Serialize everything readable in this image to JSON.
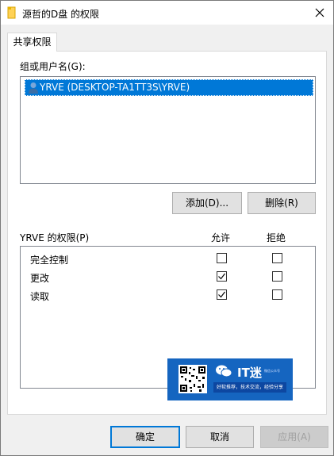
{
  "window": {
    "title": "源哲的D盘 的权限"
  },
  "tabs": [
    {
      "label": "共享权限"
    }
  ],
  "group_section": {
    "label": "组或用户名(G):",
    "users": [
      {
        "name": "YRVE (DESKTOP-TA1TT3S\\YRVE)",
        "selected": true
      }
    ]
  },
  "buttons": {
    "add": "添加(D)...",
    "remove": "删除(R)",
    "ok": "确定",
    "cancel": "取消",
    "apply": "应用(A)"
  },
  "permissions": {
    "header": "YRVE 的权限(P)",
    "allow_header": "允许",
    "deny_header": "拒绝",
    "rows": [
      {
        "name": "完全控制",
        "allow": false,
        "deny": false
      },
      {
        "name": "更改",
        "allow": true,
        "deny": false
      },
      {
        "name": "读取",
        "allow": true,
        "deny": false
      }
    ]
  },
  "watermark": {
    "title": "IT迷",
    "small": "微信公众号",
    "tagline": "好软推荐，技术交流，经验分享"
  },
  "colors": {
    "selection": "#0078d7",
    "watermark_bg": "#1565c0"
  }
}
